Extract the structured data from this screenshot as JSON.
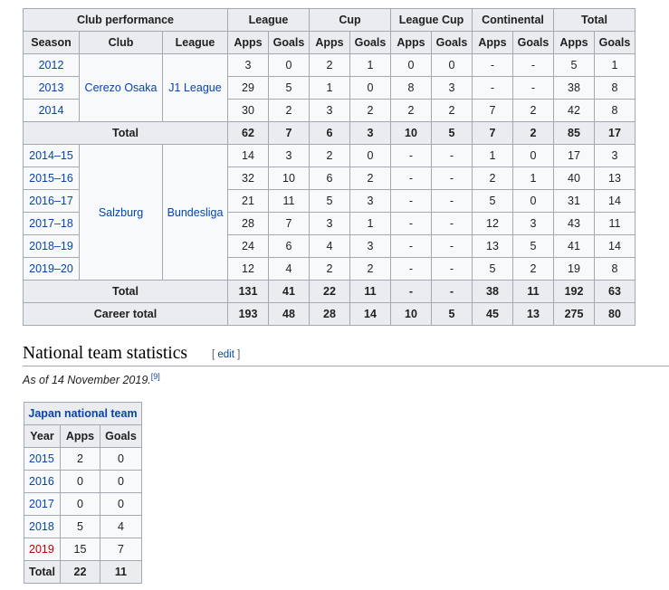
{
  "club_table": {
    "headers": {
      "club_performance": "Club performance",
      "league": "League",
      "cup": "Cup",
      "league_cup": "League Cup",
      "continental": "Continental",
      "total": "Total",
      "season": "Season",
      "club": "Club",
      "league_col": "League",
      "apps": "Apps",
      "goals": "Goals"
    },
    "cerezo": {
      "club": "Cerezo Osaka",
      "league": "J1 League",
      "rows": [
        {
          "season": "2012",
          "v": [
            "3",
            "0",
            "2",
            "1",
            "0",
            "0",
            "-",
            "-",
            "5",
            "1"
          ]
        },
        {
          "season": "2013",
          "v": [
            "29",
            "5",
            "1",
            "0",
            "8",
            "3",
            "-",
            "-",
            "38",
            "8"
          ]
        },
        {
          "season": "2014",
          "v": [
            "30",
            "2",
            "3",
            "2",
            "2",
            "2",
            "7",
            "2",
            "42",
            "8"
          ]
        }
      ],
      "total_label": "Total",
      "total": [
        "62",
        "7",
        "6",
        "3",
        "10",
        "5",
        "7",
        "2",
        "85",
        "17"
      ]
    },
    "salzburg": {
      "club": "Salzburg",
      "league": "Bundesliga",
      "rows": [
        {
          "season": "2014–15",
          "v": [
            "14",
            "3",
            "2",
            "0",
            "-",
            "-",
            "1",
            "0",
            "17",
            "3"
          ]
        },
        {
          "season": "2015–16",
          "v": [
            "32",
            "10",
            "6",
            "2",
            "-",
            "-",
            "2",
            "1",
            "40",
            "13"
          ]
        },
        {
          "season": "2016–17",
          "v": [
            "21",
            "11",
            "5",
            "3",
            "-",
            "-",
            "5",
            "0",
            "31",
            "14"
          ]
        },
        {
          "season": "2017–18",
          "v": [
            "28",
            "7",
            "3",
            "1",
            "-",
            "-",
            "12",
            "3",
            "43",
            "11"
          ]
        },
        {
          "season": "2018–19",
          "v": [
            "24",
            "6",
            "4",
            "3",
            "-",
            "-",
            "13",
            "5",
            "41",
            "14"
          ]
        },
        {
          "season": "2019–20",
          "v": [
            "12",
            "4",
            "2",
            "2",
            "-",
            "-",
            "5",
            "2",
            "19",
            "8"
          ]
        }
      ],
      "total_label": "Total",
      "total": [
        "131",
        "41",
        "22",
        "11",
        "-",
        "-",
        "38",
        "11",
        "192",
        "63"
      ]
    },
    "career_label": "Career total",
    "career": [
      "193",
      "48",
      "28",
      "14",
      "10",
      "5",
      "45",
      "13",
      "275",
      "80"
    ]
  },
  "section": {
    "title": "National team statistics",
    "edit_open": "[ ",
    "edit_label": "edit",
    "edit_close": " ]",
    "as_of": "As of 14 November 2019.",
    "ref": "[9]"
  },
  "national_table": {
    "team": "Japan national team",
    "headers": {
      "year": "Year",
      "apps": "Apps",
      "goals": "Goals"
    },
    "rows": [
      {
        "year": "2015",
        "apps": "2",
        "goals": "0"
      },
      {
        "year": "2016",
        "apps": "0",
        "goals": "0"
      },
      {
        "year": "2017",
        "apps": "0",
        "goals": "0"
      },
      {
        "year": "2018",
        "apps": "5",
        "goals": "4"
      },
      {
        "year": "2019",
        "apps": "15",
        "goals": "7"
      }
    ],
    "total_label": "Total",
    "total_apps": "22",
    "total_goals": "11"
  },
  "colors": {
    "link": "#0645ad",
    "redlink": "#ba0000",
    "header_bg": "#eaecf0",
    "cell_bg": "#f8f9fa",
    "border": "#a2a9b1"
  }
}
